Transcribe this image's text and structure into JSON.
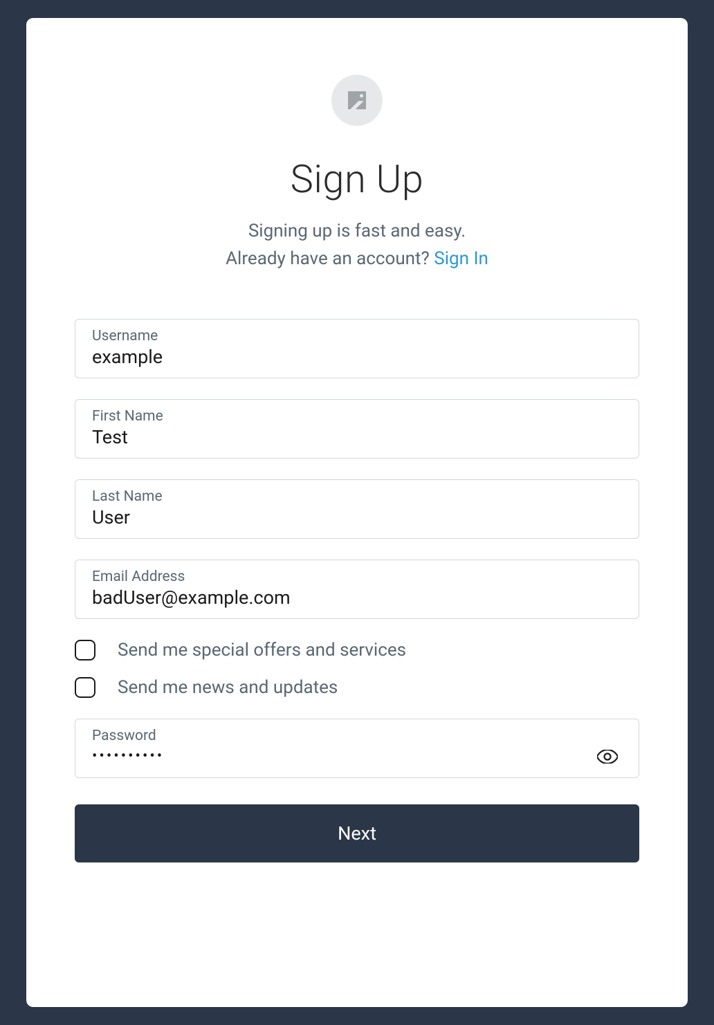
{
  "header": {
    "title": "Sign Up",
    "subtitle_line1": "Signing up is fast and easy.",
    "subtitle_line2_prefix": "Already have an account? ",
    "signin_link": "Sign In"
  },
  "form": {
    "username": {
      "label": "Username",
      "value": "example"
    },
    "firstname": {
      "label": "First Name",
      "value": "Test"
    },
    "lastname": {
      "label": "Last Name",
      "value": "User"
    },
    "email": {
      "label": "Email Address",
      "value": "badUser@example.com"
    },
    "password": {
      "label": "Password",
      "value": "••••••••••"
    }
  },
  "checkboxes": {
    "offers": {
      "label": "Send me special offers and services",
      "checked": false
    },
    "news": {
      "label": "Send me news and updates",
      "checked": false
    }
  },
  "button": {
    "next": "Next"
  }
}
